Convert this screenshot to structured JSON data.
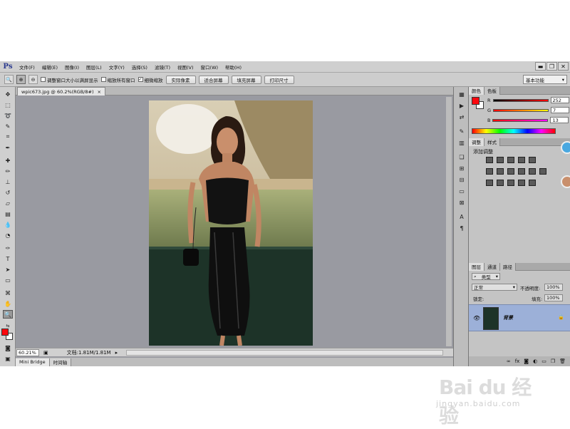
{
  "app": {
    "logo": "Ps"
  },
  "menu": [
    "文件(F)",
    "编辑(E)",
    "图像(I)",
    "图层(L)",
    "文字(Y)",
    "选择(S)",
    "滤镜(T)",
    "视图(V)",
    "窗口(W)",
    "帮助(H)"
  ],
  "window_controls": {
    "minimize": "▬",
    "restore": "❐",
    "close": "✕"
  },
  "options": {
    "resize_windows": "调整窗口大小以满屏显示",
    "zoom_all_windows": "缩放所有窗口",
    "scrubby_zoom": "细微缩放",
    "actual_pixels": "实际像素",
    "fit_screen": "适合屏幕",
    "fill_screen": "填充屏幕",
    "print_size": "打印尺寸",
    "workspace": "基本功能"
  },
  "document": {
    "tab_title": "wpic673.jpg @ 60.2%(RGB/8#)",
    "tab_close": "×",
    "zoom": "60.21%",
    "doc_size": "文档:1.81M/1.81M"
  },
  "bottom_tabs": [
    "Mini Bridge",
    "时间轴"
  ],
  "color_panel": {
    "tabs": [
      "颜色",
      "色板"
    ],
    "r_label": "R",
    "g_label": "G",
    "b_label": "B",
    "r": "252",
    "g": "7",
    "b": "13",
    "foreground": "#fc070d"
  },
  "adjust_panel": {
    "tabs": [
      "调整",
      "样式"
    ],
    "title": "添加调整"
  },
  "layers_panel": {
    "tabs": [
      "图层",
      "通道",
      "路径"
    ],
    "filter": "类型",
    "blend_mode": "正常",
    "opacity_label": "不透明度:",
    "opacity": "100%",
    "lock_label": "锁定:",
    "fill_label": "填充:",
    "fill": "100%",
    "layer_name": "背景"
  },
  "watermark": {
    "brand": "Bai du 经验",
    "url": "jingyan.baidu.com"
  }
}
